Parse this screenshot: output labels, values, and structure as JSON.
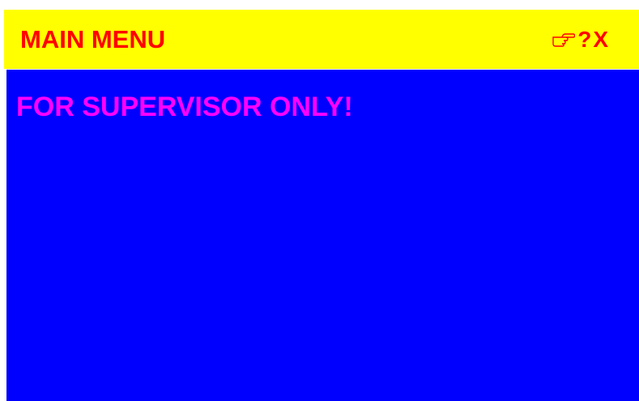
{
  "colors": {
    "header_bg": "#ffff00",
    "header_text": "#ff0000",
    "panel_bg": "#0000ff",
    "warning_text": "#ff00ff"
  },
  "header": {
    "title": "MAIN MENU",
    "hand_icon": "pointing-hand-icon",
    "help_label": "?",
    "close_label": "X"
  },
  "main": {
    "message": "FOR SUPERVISOR ONLY!"
  }
}
